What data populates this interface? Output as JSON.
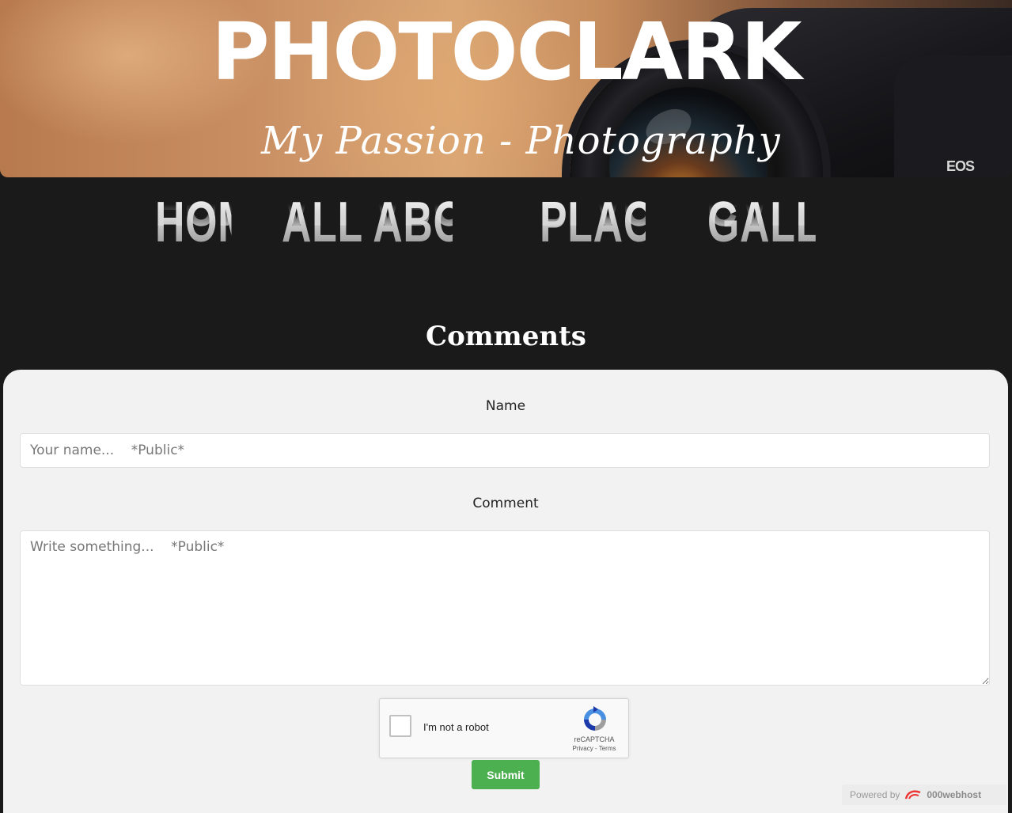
{
  "banner": {
    "title": "PHOTOCLARK",
    "tagline": "My Passion - Photography",
    "camera_badge": "EOS"
  },
  "nav": {
    "items": [
      {
        "label": "Home"
      },
      {
        "label": "All About Me"
      },
      {
        "label": "Places"
      },
      {
        "label": "Gallery"
      }
    ]
  },
  "comments": {
    "heading": "Comments",
    "name_label": "Name",
    "name_placeholder": "Your name...    *Public*",
    "comment_label": "Comment",
    "comment_placeholder": "Write something...    *Public*",
    "captcha_label": "I'm not a robot",
    "captcha_brand": "reCAPTCHA",
    "captcha_links": "Privacy - Terms",
    "submit_label": "Submit"
  },
  "footer": {
    "powered_by": "Powered by",
    "host_brand": "000webhost"
  },
  "colors": {
    "page_bg": "#1a1a1a",
    "panel_bg": "#f2f2f2",
    "submit_bg": "#4caf50"
  }
}
